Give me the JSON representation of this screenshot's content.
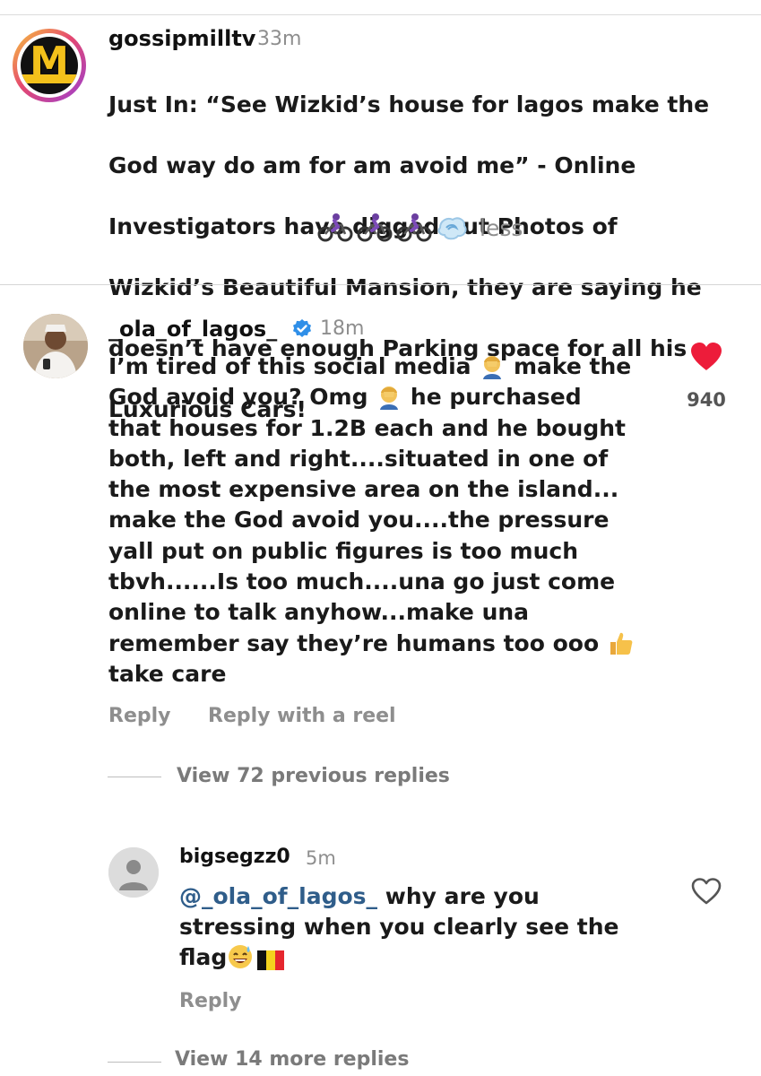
{
  "caption": {
    "username": "gossipmilltv",
    "time": "33m",
    "text_lines": [
      "Just In: “See Wizkid’s house for lagos make the",
      "God way do am for am avoid me” - Online",
      "Investigators have digged out Photos of",
      "Wizkid’s Beautiful Mansion, they are saying he",
      "doesn’t have enough Parking space for all his",
      "Luxurious Cars!"
    ],
    "less_label": "less",
    "avatar_letter": "M",
    "icons": [
      "bicyclist-emoji",
      "bicyclist-emoji",
      "bicyclist-emoji",
      "dash-emoji"
    ]
  },
  "comment": {
    "username": "_ola_of_lagos_",
    "verified": true,
    "time": "18m",
    "lines": [
      [
        "I’m tired of this social media ",
        "",
        " make the"
      ],
      [
        "God avoid you? Omg ",
        "",
        " he purchased"
      ],
      [
        "that houses for 1.2B each and he bought"
      ],
      [
        "both, left and right....situated in one of"
      ],
      [
        "the most expensive area on the island..."
      ],
      [
        "make the God avoid you....the pressure"
      ],
      [
        "yall put on public figures is too much"
      ],
      [
        "tbvh......Is too much....una go just come"
      ],
      [
        "online to talk anyhow...make una"
      ],
      [
        "remember say they’re humans too ooo ",
        ""
      ],
      [
        "take care"
      ]
    ],
    "like_count": "940",
    "liked": true,
    "reply_label": "Reply",
    "reply_reel_label": "Reply with a reel",
    "view_previous_label": "View 72 previous replies"
  },
  "reply": {
    "username": "bigsegzz0",
    "time": "5m",
    "mention": "@_ola_of_lagos_",
    "line1_rest": " why are you",
    "line2": "stressing when you clearly see the",
    "line3": "flag",
    "reply_label": "Reply",
    "view_more_label": "View 14 more replies",
    "liked": false
  },
  "colors": {
    "heart_red": "#ed1c3a",
    "verified_blue": "#2f8fe8",
    "muted_gray": "#8e8e8e",
    "mention_blue": "#2f5d8a"
  }
}
